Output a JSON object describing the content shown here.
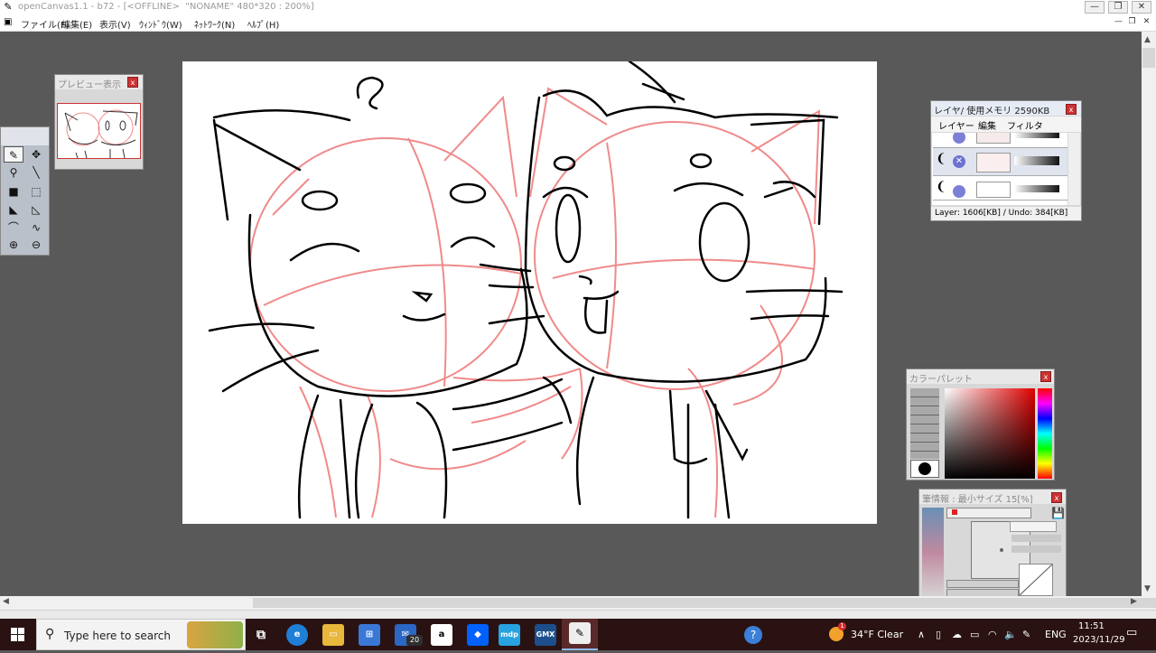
{
  "window": {
    "title": "openCanvas1.1 - b72 - [<OFFLINE>  \"NONAME\" 480*320 : 200%]",
    "minimize": "—",
    "restore": "❐",
    "close": "✕"
  },
  "menu": {
    "items": [
      "ファイル(F)",
      "編集(E)",
      "表示(V)",
      "ｳｨﾝﾄﾞｳ(W)",
      "ﾈｯﾄﾜｰｸ(N)",
      "ﾍﾙﾌﾟ(H)"
    ]
  },
  "mdi": {
    "minimize": "—",
    "restore": "❐",
    "close": "✕"
  },
  "preview": {
    "title": "プレビュー表示",
    "close": "x"
  },
  "layers": {
    "title": "レイヤ/ 使用メモリ 2590KB",
    "menu": [
      "レイヤー",
      "編集",
      "フィルタ"
    ],
    "status": "Layer: 1606[KB] / Undo: 384[KB]",
    "close": "x"
  },
  "palette": {
    "title": "カラーパレット",
    "close": "x"
  },
  "brush": {
    "title": "筆情報 : 最小サイズ 15[%]",
    "close": "x"
  },
  "scroll": {
    "left": "◀",
    "right": "▶",
    "up": "▲",
    "down": "▼"
  },
  "taskbar": {
    "search_placeholder": "Type here to search",
    "mail_badge": "20",
    "weather": "34°F  Clear",
    "lang": "ENG",
    "time": "11:51",
    "date": "2023/11/29",
    "weather_badge": "1",
    "apps": [
      "task-view",
      "edge",
      "file-explorer",
      "store",
      "mail",
      "amazon",
      "dropbox",
      "mdp",
      "gmx",
      "opencanvas"
    ]
  },
  "colors": {
    "titlebar_text": "#9a9a9a",
    "workspace": "#595959",
    "sketch_red": "#f08a8a",
    "ink": "#000000",
    "panel_close": "#cc3333",
    "taskbar": "#2a1212"
  }
}
